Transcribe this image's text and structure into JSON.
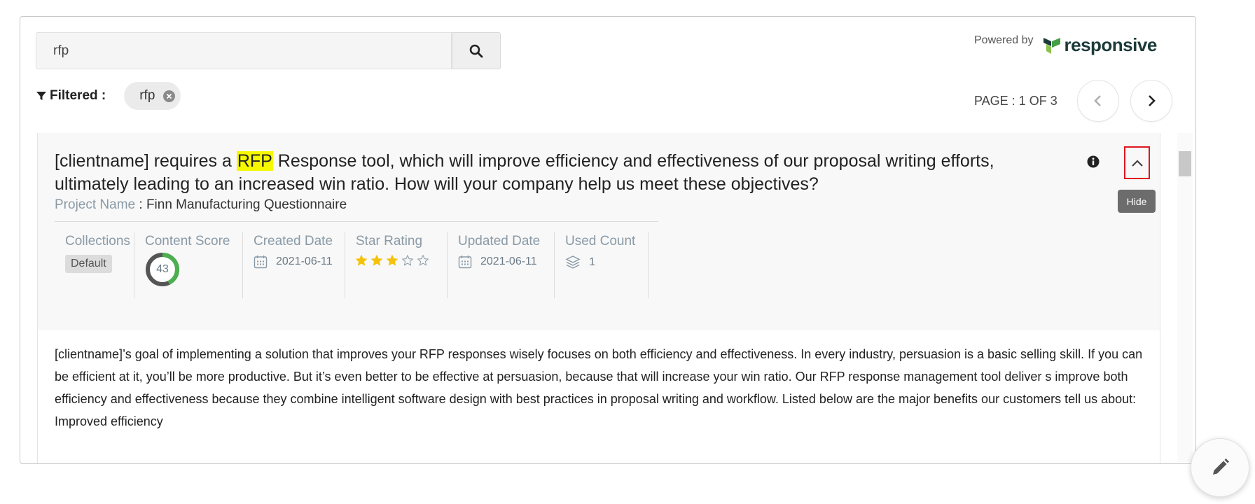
{
  "search": {
    "value": "rfp",
    "button_icon": "search-icon"
  },
  "filter": {
    "label": "Filtered :",
    "chips": [
      {
        "text": "rfp"
      }
    ]
  },
  "branding": {
    "powered_by": "Powered by",
    "brand_name": "responsive",
    "brand_color": "#2f9b3b"
  },
  "pagination": {
    "text": "PAGE : 1 OF 3"
  },
  "result": {
    "question_before": "[clientname] requires a ",
    "question_highlight": "RFP",
    "question_after": " Response tool, which will improve efficiency and effectiveness of our proposal writing efforts, ultimately leading to an increased win ratio. How will your company help us meet these objectives?",
    "project_label": "Project Name",
    "project_value": " : Finn Manufacturing Questionnaire",
    "tooltip": "Hide",
    "meta": {
      "collections_label": "Collections",
      "collections_value": "Default",
      "content_score_label": "Content Score",
      "content_score_value": "43",
      "content_score_percent": 43,
      "created_label": "Created Date",
      "created_value": "2021-06-11",
      "star_label": "Star Rating",
      "star_value": 3,
      "star_max": 5,
      "updated_label": "Updated Date",
      "updated_value": "2021-06-11",
      "used_label": "Used Count",
      "used_value": "1"
    },
    "answer_text": "[clientname]’s goal of implementing a solution that improves your RFP responses wisely focuses on both efficiency and effectiveness. In every industry, persuasion is a basic selling skill. If you can be efficient at it, you’ll be more productive. But it’s even better to be effective at persuasion, because that will increase your win ratio.  Our RFP response management tool deliver s improve both efficiency and effectiveness because they combine intelligent software design with best practices in proposal writing and workflow.  Listed below are the major benefits our customers tell us about:",
    "answer_next": "Improved efficiency"
  },
  "colors": {
    "highlight": "#f6f800",
    "accent_red": "#e0161f",
    "star": "#f4c20d",
    "score_green": "#4caf50",
    "score_dark": "#555555"
  }
}
